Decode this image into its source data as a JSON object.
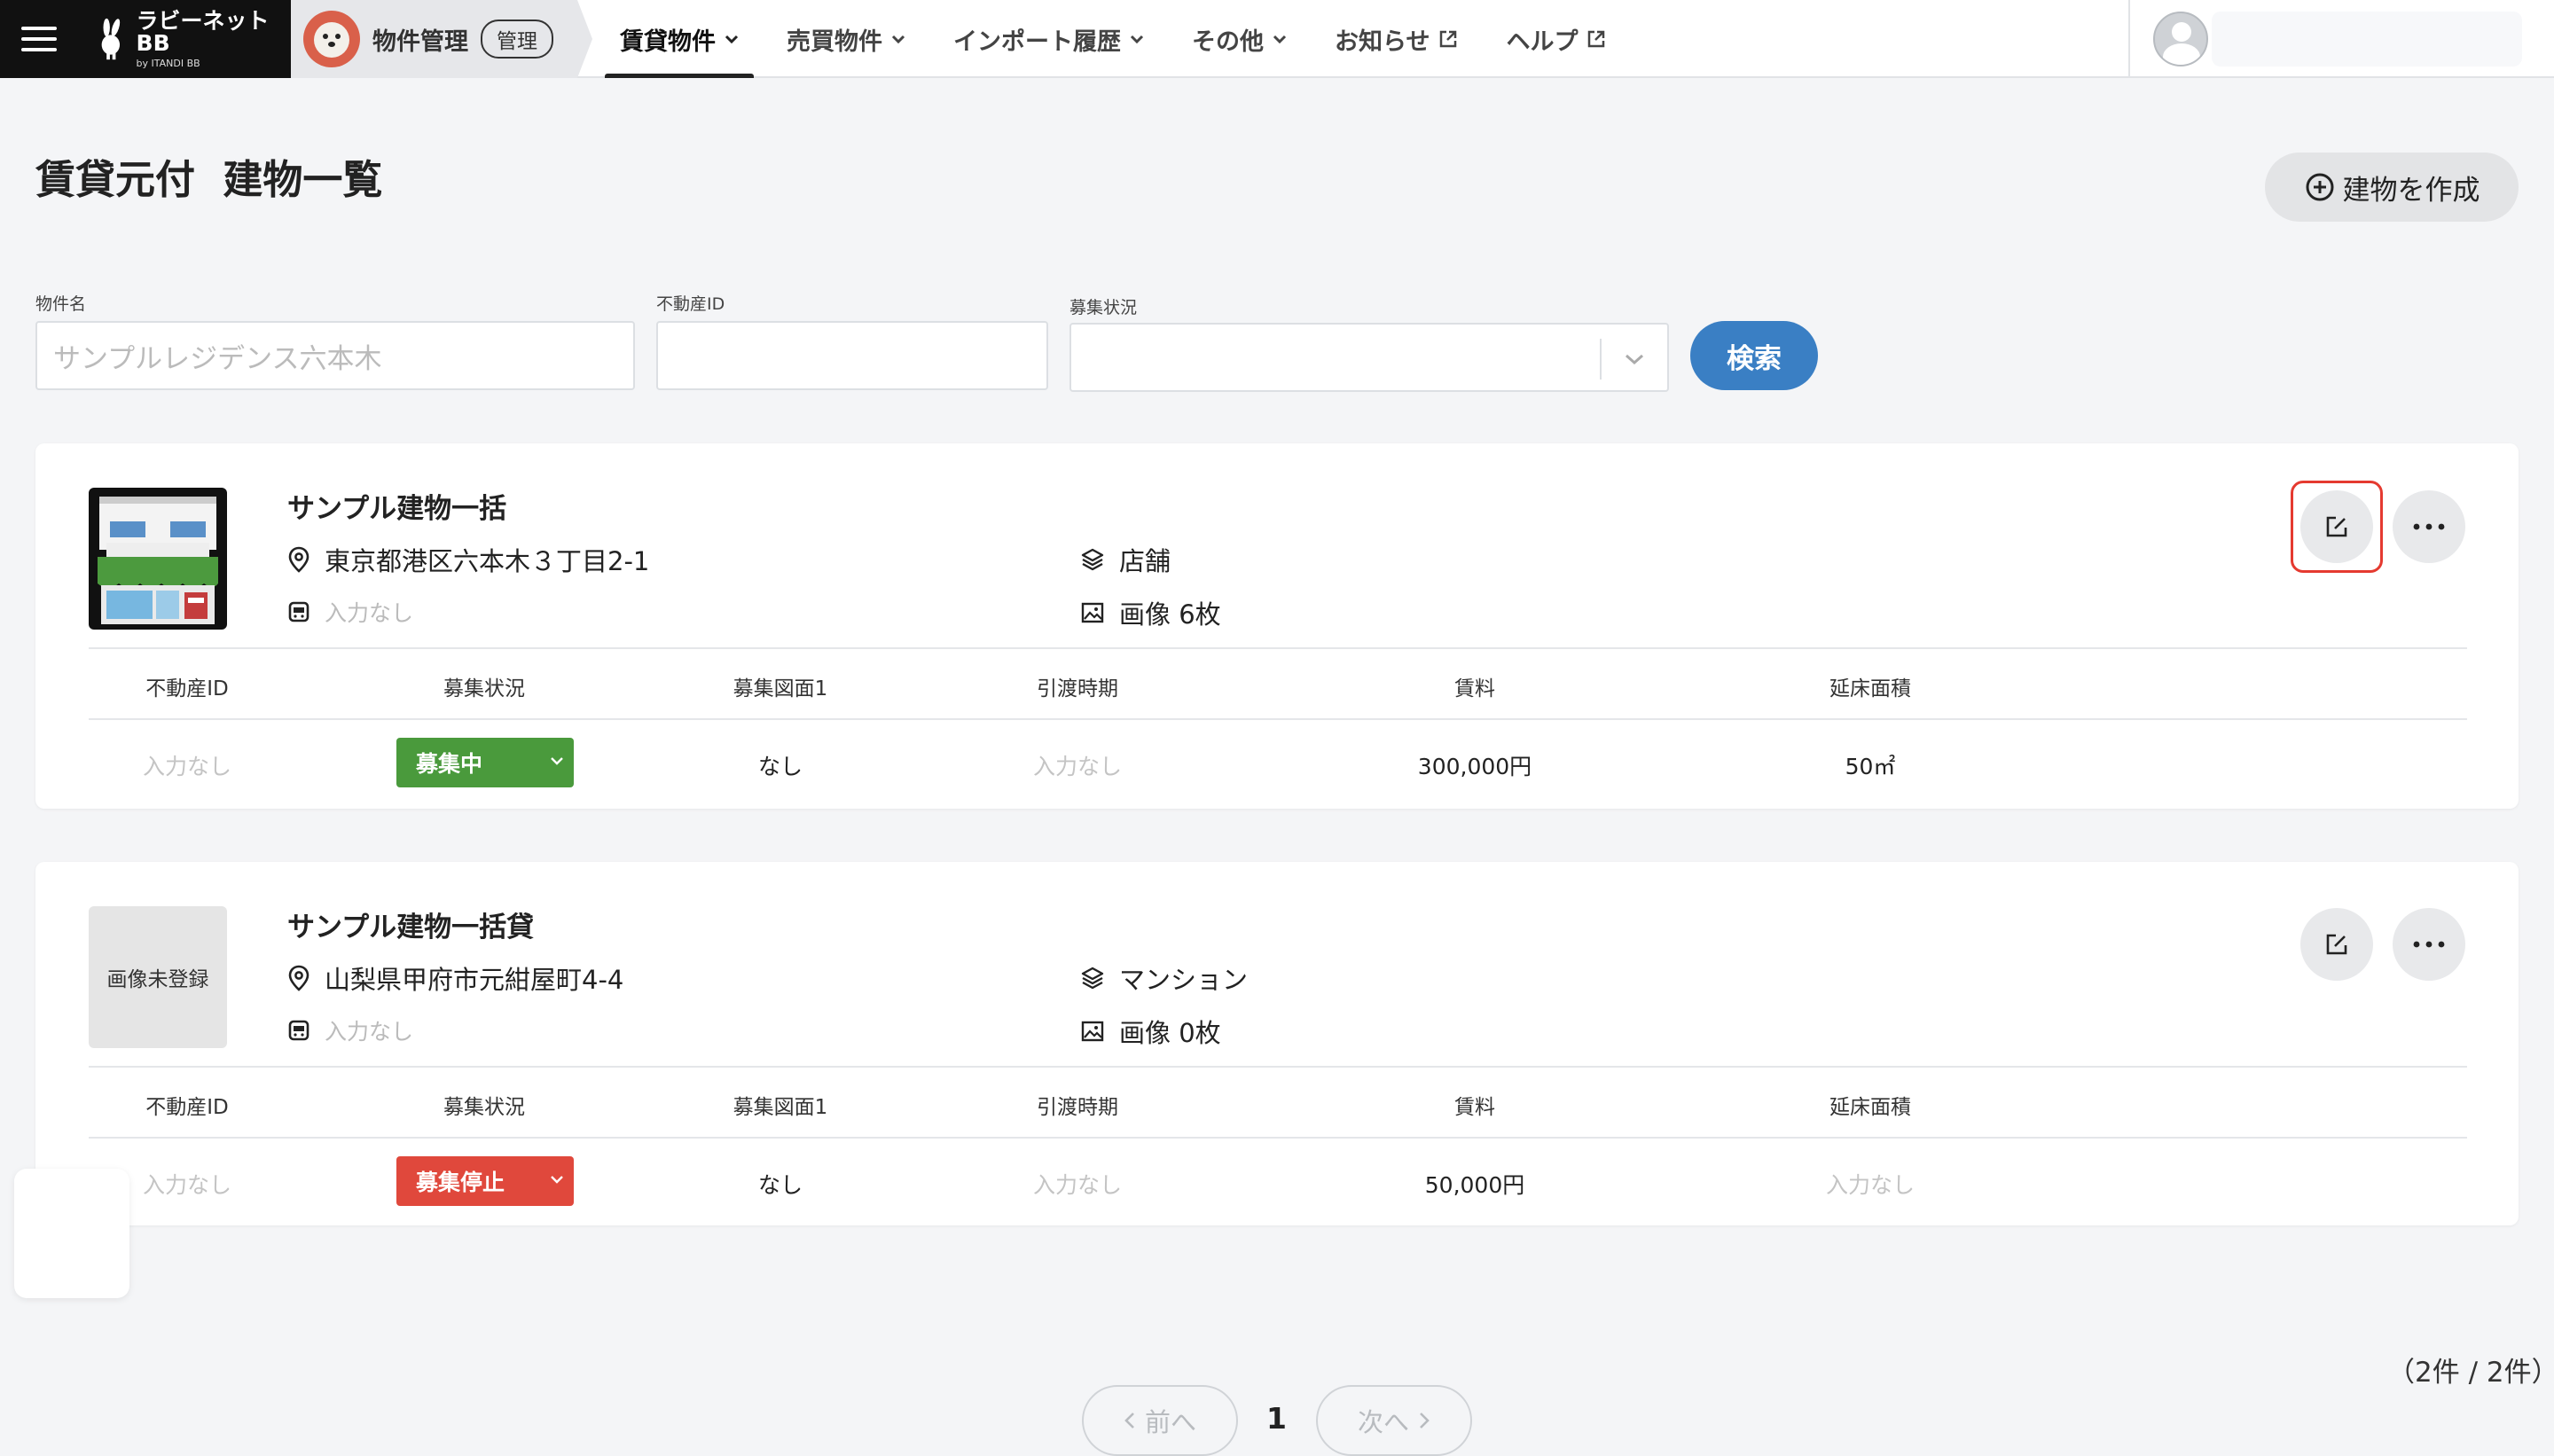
{
  "header": {
    "logo_main": "ラビーネットBB",
    "logo_sub": "by ITANDI BB",
    "app_name": "物件管理",
    "app_badge": "管理",
    "nav": [
      {
        "label": "賃貸物件"
      },
      {
        "label": "売買物件"
      },
      {
        "label": "インポート履歴"
      },
      {
        "label": "その他"
      },
      {
        "label": "お知らせ"
      },
      {
        "label": "ヘルプ"
      }
    ]
  },
  "page": {
    "title": "賃貸元付  建物一覧",
    "create_button": "建物を作成"
  },
  "filters": {
    "name_label": "物件名",
    "name_placeholder": "サンプルレジデンス六本木",
    "id_label": "不動産ID",
    "status_label": "募集状況",
    "search_button": "検索"
  },
  "columns": [
    "不動産ID",
    "募集状況",
    "募集図面1",
    "引渡時期",
    "賃料",
    "延床面積"
  ],
  "buildings": [
    {
      "name": "サンプル建物一括",
      "address": "東京都港区六本木３丁目2-1",
      "type": "店舗",
      "station": "入力なし",
      "images": "画像 6枚",
      "row": {
        "realestate_id": "入力なし",
        "status": "募集中",
        "drawing": "なし",
        "delivery": "入力なし",
        "rent": "300,000円",
        "floor_area": "50㎡"
      }
    },
    {
      "name": "サンプル建物一括貸",
      "thumb_text": "画像未登録",
      "address": "山梨県甲府市元紺屋町4-4",
      "type": "マンション",
      "station": "入力なし",
      "images": "画像 0枚",
      "row": {
        "realestate_id": "入力なし",
        "status": "募集停止",
        "drawing": "なし",
        "delivery": "入力なし",
        "rent": "50,000円",
        "floor_area": "入力なし"
      }
    }
  ],
  "pagination": {
    "count_text": "（2件 / 2件）",
    "prev": "前へ",
    "current": "1",
    "next": "次へ"
  },
  "colors": {
    "status_active": "#4a9a3c",
    "status_stopped": "#e0483c",
    "search_button": "#3a7fc4",
    "highlight": "#e53a30"
  }
}
